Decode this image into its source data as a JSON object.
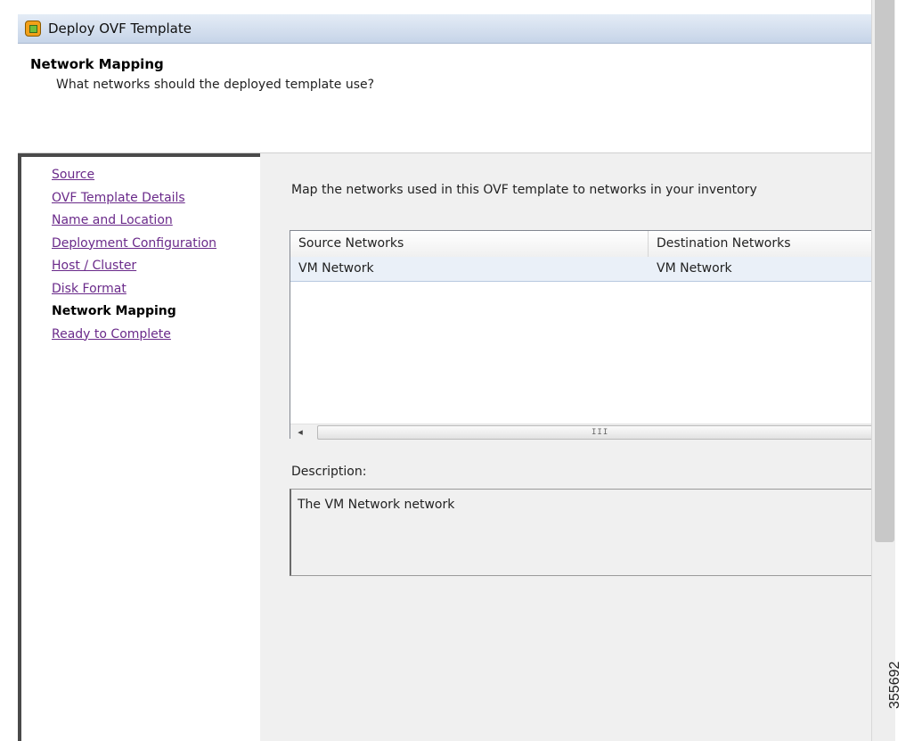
{
  "window": {
    "title": "Deploy OVF Template",
    "icon": "ovf-deploy-icon"
  },
  "header": {
    "step_title": "Network Mapping",
    "step_subtitle": "What networks should the deployed template use?"
  },
  "nav": {
    "items": [
      {
        "label": "Source"
      },
      {
        "label": "OVF Template Details"
      },
      {
        "label": "Name and Location"
      },
      {
        "label": "Deployment Configuration"
      },
      {
        "label": "Host / Cluster"
      },
      {
        "label": "Disk Format"
      },
      {
        "label": "Network Mapping"
      },
      {
        "label": "Ready to Complete"
      }
    ],
    "current": "Network Mapping"
  },
  "main": {
    "instruction": "Map the networks used in this OVF template to networks in your inventory",
    "table": {
      "columns": [
        "Source Networks",
        "Destination Networks"
      ],
      "rows": [
        {
          "source": "VM Network",
          "destination": "VM Network"
        }
      ],
      "scroll_grip": "III",
      "scroll_left_arrow": "◂"
    },
    "description_label": "Description:",
    "description_text": "The VM Network network"
  },
  "figure_id": "355692",
  "colors": {
    "link": "#6a2a8a",
    "titlebar": "#c6d4e8",
    "panel": "#f0f0f0"
  }
}
